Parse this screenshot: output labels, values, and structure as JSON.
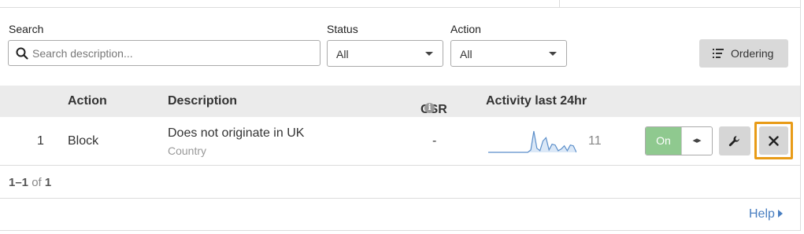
{
  "filters": {
    "search_label": "Search",
    "search_placeholder": "Search description...",
    "status_label": "Status",
    "status_value": "All",
    "action_label": "Action",
    "action_value": "All",
    "ordering_label": "Ordering"
  },
  "table": {
    "headers": {
      "action": "Action",
      "description": "Description",
      "csr": "CSR",
      "activity": "Activity last 24hr"
    },
    "rows": [
      {
        "index": "1",
        "action": "Block",
        "description": "Does not originate in UK",
        "sub": "Country",
        "csr": "-",
        "activity_count": "11",
        "activity_series": [
          0,
          0,
          0,
          0,
          0,
          0,
          0,
          0,
          0,
          0,
          0,
          0,
          0,
          0,
          3,
          26,
          5,
          2,
          14,
          18,
          3,
          10,
          9,
          2,
          4,
          8,
          2,
          9,
          8,
          0
        ],
        "toggle_label": "On"
      }
    ]
  },
  "pager": {
    "range": "1–1",
    "of": "of",
    "total": "1"
  },
  "help_label": "Help",
  "colors": {
    "accent": "#4a7fc1",
    "toggle_on": "#8fc98f",
    "focus_outline": "#e89b17"
  }
}
